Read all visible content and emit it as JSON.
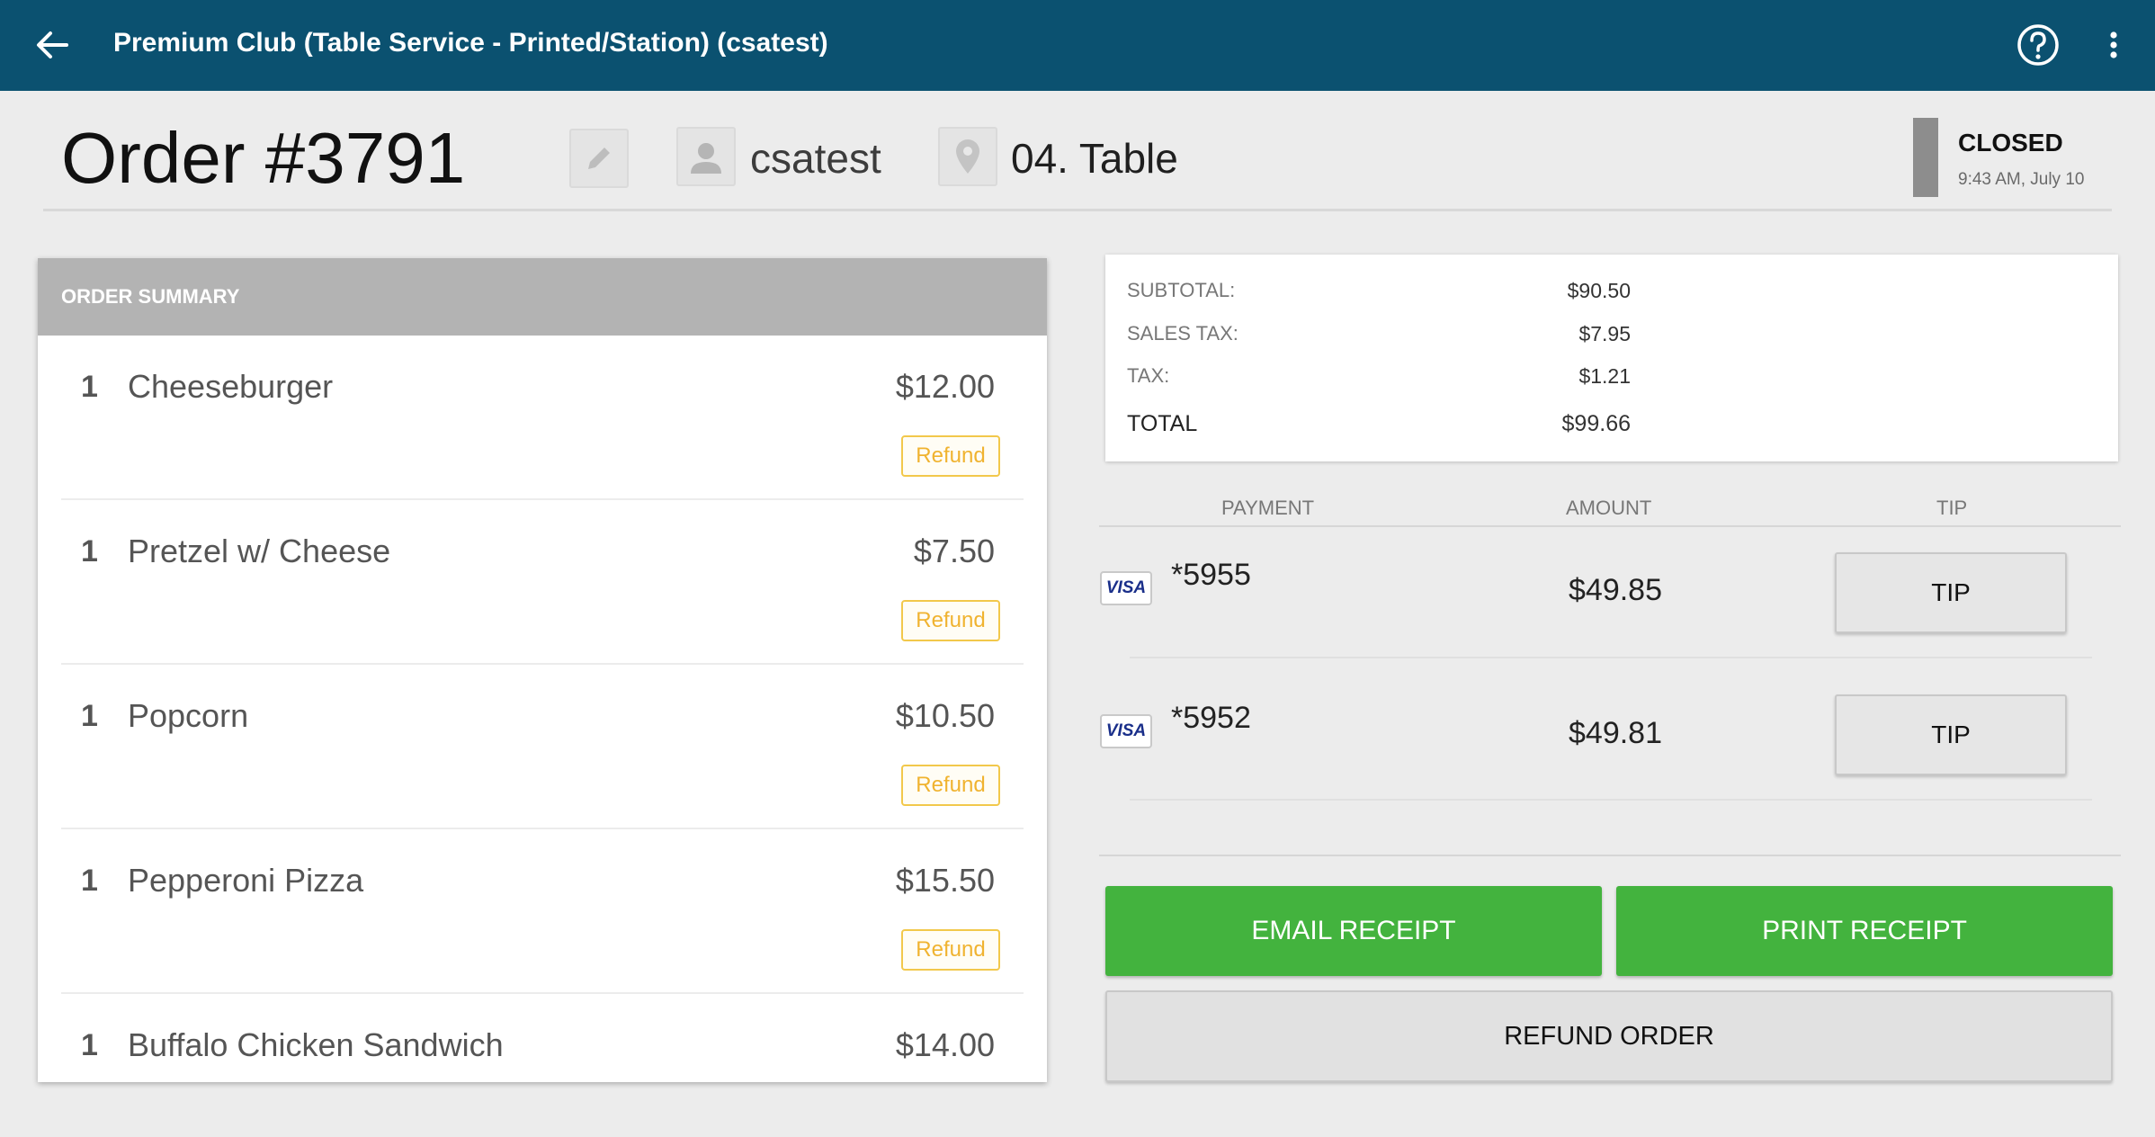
{
  "app": {
    "title": "Premium Club (Table Service - Printed/Station) (csatest)"
  },
  "order": {
    "title": "Order #3791",
    "user": "csatest",
    "location": "04. Table",
    "status": "CLOSED",
    "status_time": "9:43 AM, July 10"
  },
  "summary": {
    "header": "ORDER SUMMARY",
    "refund_label": "Refund",
    "items": [
      {
        "qty": "1",
        "name": "Cheeseburger",
        "price": "$12.00"
      },
      {
        "qty": "1",
        "name": "Pretzel w/ Cheese",
        "price": "$7.50"
      },
      {
        "qty": "1",
        "name": "Popcorn",
        "price": "$10.50"
      },
      {
        "qty": "1",
        "name": "Pepperoni Pizza",
        "price": "$15.50"
      },
      {
        "qty": "1",
        "name": "Buffalo Chicken Sandwich",
        "price": "$14.00"
      }
    ]
  },
  "totals": {
    "subtotal_label": "SUBTOTAL:",
    "subtotal": "$90.50",
    "sales_tax_label": "SALES TAX:",
    "sales_tax": "$7.95",
    "tax_label": "TAX:",
    "tax": "$1.21",
    "total_label": "TOTAL",
    "total": "$99.66"
  },
  "payments": {
    "headers": {
      "payment": "PAYMENT",
      "amount": "AMOUNT",
      "tip": "TIP"
    },
    "rows": [
      {
        "card_brand": "VISA",
        "card": "*5955",
        "amount": "$49.85",
        "tip_label": "TIP"
      },
      {
        "card_brand": "VISA",
        "card": "*5952",
        "amount": "$49.81",
        "tip_label": "TIP"
      }
    ]
  },
  "actions": {
    "email_receipt": "EMAIL RECEIPT",
    "print_receipt": "PRINT RECEIPT",
    "refund_order": "REFUND ORDER"
  },
  "colors": {
    "topbar": "#0b5170",
    "primary_action": "#43b33e",
    "refund_accent": "#f0b330",
    "status_indicator": "#8d8d8d"
  }
}
